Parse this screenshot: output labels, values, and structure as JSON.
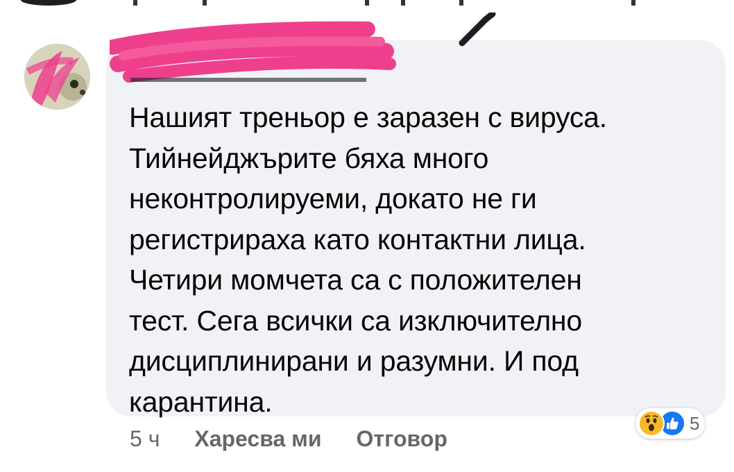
{
  "comment": {
    "author_name": "",
    "text": "Нашият треньор е заразен с вируса.\nТийнейджърите бяха много\nнеконтролируеми, докато не ги\nрегистрираха като контактни лица.\nЧетири момчета са с положителен\nтест. Сега всички са изключително\nдисциплинирани и разумни. И под\nкарантина."
  },
  "actions": {
    "time": "5 ч",
    "like_label": "Харесва ми",
    "reply_label": "Отговор"
  },
  "reactions": {
    "icons": [
      "wow-icon",
      "like-icon"
    ],
    "count": "5"
  },
  "colors": {
    "bubble": "#f0f2f5",
    "text": "#050505",
    "secondary": "#65676b",
    "like_blue": "#1877f2",
    "wow_yellow": "#f7b928",
    "redaction_pink": "#ee3f8d"
  }
}
